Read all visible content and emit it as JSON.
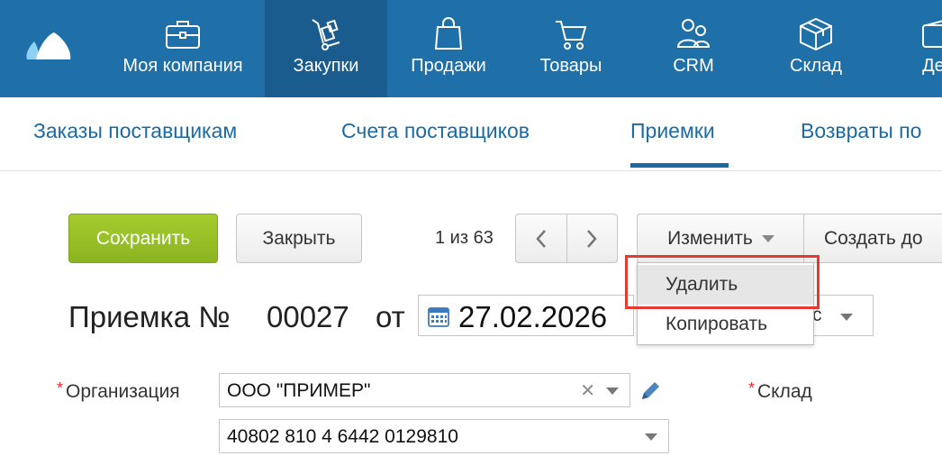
{
  "nav": {
    "items": [
      {
        "label": "Моя компания",
        "icon": "briefcase-icon"
      },
      {
        "label": "Закупки",
        "icon": "cart-dolly-icon",
        "active": true
      },
      {
        "label": "Продажи",
        "icon": "shopping-bag-icon"
      },
      {
        "label": "Товары",
        "icon": "shopping-cart-icon"
      },
      {
        "label": "CRM",
        "icon": "people-icon"
      },
      {
        "label": "Склад",
        "icon": "box-icon"
      },
      {
        "label": "Ден",
        "icon": "wallet-icon"
      }
    ]
  },
  "subtabs": {
    "items": [
      {
        "label": "Заказы поставщикам"
      },
      {
        "label": "Счета поставщиков"
      },
      {
        "label": "Приемки",
        "active": true
      },
      {
        "label": "Возвраты по"
      }
    ]
  },
  "toolbar": {
    "save_label": "Сохранить",
    "close_label": "Закрыть",
    "pager_text": "1 из 63",
    "change_label": "Изменить",
    "create_label": "Создать до"
  },
  "menu": {
    "delete_label": "Удалить",
    "copy_label": "Копировать"
  },
  "document": {
    "title": "Приемка №",
    "number": "00027",
    "from_label": "от",
    "date": "27.02.2026",
    "time_partial": "c"
  },
  "form": {
    "organization_label": "Организация",
    "organization_value": "ООО \"ПРИМЕР\"",
    "account_value": "40802 810 4 6442 0129810",
    "warehouse_label": "Склад",
    "required_mark": "*"
  },
  "colors": {
    "nav_bg": "#1f6fa8",
    "nav_active": "#1a5c8e",
    "link": "#1b6aa5",
    "save_green": "#98c127",
    "highlight_red": "#e53a2f"
  }
}
